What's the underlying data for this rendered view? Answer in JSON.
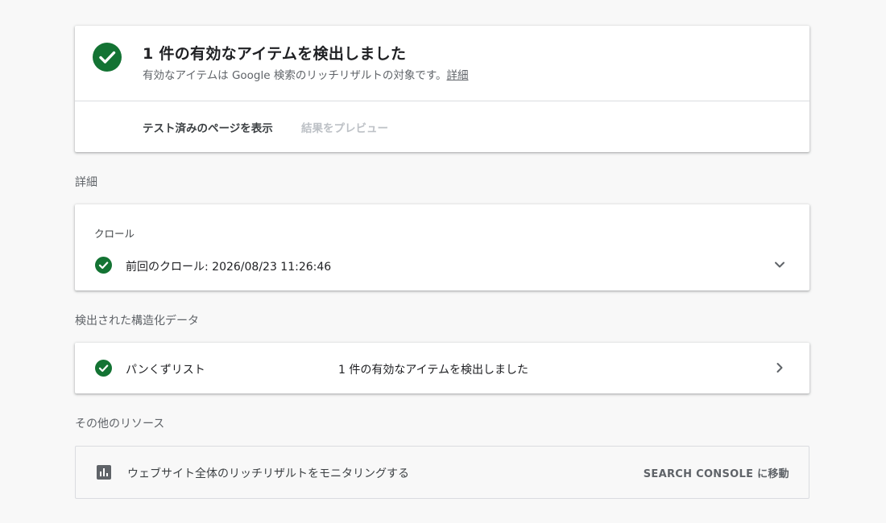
{
  "summary": {
    "title": "1 件の有効なアイテムを検出しました",
    "subtitle": "有効なアイテムは Google 検索のリッチリザルトの対象です。",
    "details_link": "詳細",
    "tested_page_button": "テスト済みのページを表示",
    "preview_button": "結果をプレビュー"
  },
  "details_section": {
    "heading": "詳細",
    "crawl_label": "クロール",
    "last_crawl": "前回のクロール: 2026/08/23 11:26:46"
  },
  "structured_data_section": {
    "heading": "検出された構造化データ",
    "items": [
      {
        "name": "パンくずリスト",
        "status": "1 件の有効なアイテムを検出しました"
      }
    ]
  },
  "other_resources_section": {
    "heading": "その他のリソース",
    "monitor_text": "ウェブサイト全体のリッチリザルトをモニタリングする",
    "link_label": "SEARCH CONSOLE に移動"
  },
  "colors": {
    "success_green": "#137333",
    "background": "#f8f8f8",
    "text_primary": "#202124",
    "text_secondary": "#5f6368",
    "disabled": "#bdc1c6"
  },
  "icons": [
    "check-circle-icon",
    "chevron-down-icon",
    "chevron-right-icon",
    "bar-chart-icon"
  ]
}
